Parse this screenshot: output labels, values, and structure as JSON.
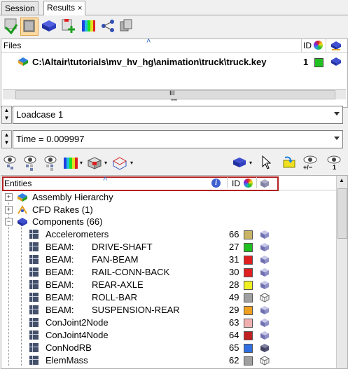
{
  "tabs": [
    {
      "label": "Session",
      "active": false
    },
    {
      "label": "Results",
      "active": true,
      "close": "×"
    }
  ],
  "toolbar_icons": [
    "load-icon",
    "open-file-icon",
    "model-icon",
    "add-result-icon",
    "contour-icon",
    "tree-icon",
    "layers-icon"
  ],
  "files": {
    "header_label": "Files",
    "id_label": "ID",
    "collapse_glyph": "˄",
    "path": "C:\\Altair\\tutorials\\mv_hv_hg\\animation\\truck\\truck.key",
    "id": "1",
    "color": "#22c122",
    "scroll_grip": "III",
    "splitter_grip": "▪▪▪"
  },
  "loadcase": {
    "value": "Loadcase 1"
  },
  "time": {
    "value": "Time = 0.009997"
  },
  "entity_toolbar_icons": [
    "show-icon",
    "hide-icon",
    "isolate-icon",
    "color-icon",
    "display-mode-icon",
    "transparency-icon",
    "select-icon",
    "pointer-icon",
    "paste-icon",
    "show-plus-minus-icon",
    "show-one-icon"
  ],
  "entity_toolbar_labels": {
    "plus_minus": "+/−",
    "one": "1"
  },
  "entities": {
    "header_label": "Entities",
    "id_label": "ID",
    "collapse_glyph": "˄",
    "groups": [
      {
        "label": "Assembly Hierarchy",
        "expander": "+"
      },
      {
        "label": "CFD Rakes (1)",
        "expander": "+"
      },
      {
        "label": "Components (66)",
        "expander": "−"
      }
    ],
    "components": [
      {
        "type": "Accelerometers",
        "name": "",
        "id": "66",
        "color": "#c8b464",
        "display": "shaded"
      },
      {
        "type": "BEAM:",
        "name": "DRIVE-SHAFT",
        "id": "27",
        "color": "#20c020",
        "display": "shaded"
      },
      {
        "type": "BEAM:",
        "name": "FAN-BEAM",
        "id": "31",
        "color": "#e02020",
        "display": "shaded"
      },
      {
        "type": "BEAM:",
        "name": "RAIL-CONN-BACK",
        "id": "30",
        "color": "#e02020",
        "display": "shaded"
      },
      {
        "type": "BEAM:",
        "name": "REAR-AXLE",
        "id": "28",
        "color": "#f0f020",
        "display": "shaded"
      },
      {
        "type": "BEAM:",
        "name": "ROLL-BAR",
        "id": "49",
        "color": "#a0a0a0",
        "display": "wire"
      },
      {
        "type": "BEAM:",
        "name": "SUSPENSION-REAR",
        "id": "29",
        "color": "#f0a020",
        "display": "shaded"
      },
      {
        "type": "ConJoint2Node",
        "name": "",
        "id": "63",
        "color": "#f0b0b0",
        "display": "shaded"
      },
      {
        "type": "ConJoint4Node",
        "name": "",
        "id": "64",
        "color": "#c02020",
        "display": "shaded"
      },
      {
        "type": "ConNodRB",
        "name": "",
        "id": "65",
        "color": "#3070e0",
        "display": "dark"
      },
      {
        "type": "ElemMass",
        "name": "",
        "id": "62",
        "color": "#a0a0a0",
        "display": "wire"
      }
    ]
  }
}
